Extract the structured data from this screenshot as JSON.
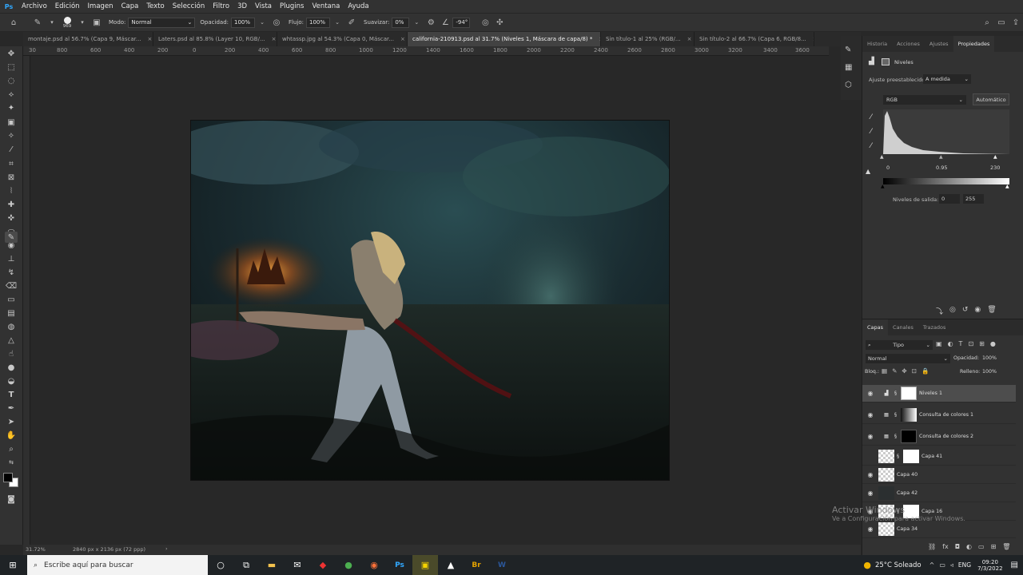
{
  "menu": {
    "logo": "Ps",
    "items": [
      "Archivo",
      "Edición",
      "Imagen",
      "Capa",
      "Texto",
      "Selección",
      "Filtro",
      "3D",
      "Vista",
      "Plugins",
      "Ventana",
      "Ayuda"
    ]
  },
  "options": {
    "brush_size": "969",
    "mode_label": "Modo:",
    "mode_value": "Normal",
    "opacity_label": "Opacidad:",
    "opacity_value": "100%",
    "flow_label": "Flujo:",
    "flow_value": "100%",
    "smooth_label": "Suavizar:",
    "smooth_value": "0%",
    "angle_value": "-94°"
  },
  "doc_tabs": [
    {
      "label": "montaje.psd al 56.7% (Capa 9, Máscar...",
      "active": false
    },
    {
      "label": "Laters.psd al 85.8% (Layer 10, RGB/...",
      "active": false
    },
    {
      "label": "whtassp.jpg al 54.3% (Capa 0, Máscar...",
      "active": false
    },
    {
      "label": "california-210913.psd al 31.7% (Niveles 1, Máscara de capa/8) *",
      "active": true
    },
    {
      "label": "Sin título-1 al 25% (RGB/...",
      "active": false
    },
    {
      "label": "Sin título-2 al 66.7% (Capa 6, RGB/8...",
      "active": false
    }
  ],
  "ruler_labels": [
    "30",
    "800",
    "600",
    "400",
    "200",
    "0",
    "200",
    "400",
    "600",
    "800",
    "1000",
    "1200",
    "1400",
    "1600",
    "1800",
    "2000",
    "2200",
    "2400",
    "2600",
    "2800",
    "3000",
    "3200",
    "3400",
    "3600"
  ],
  "status": {
    "zoom": "31.72%",
    "doc_info": "2840 px x 2136 px (72 ppp)"
  },
  "panel_tabs": [
    "Historia",
    "Acciones",
    "Ajustes",
    "Propiedades"
  ],
  "properties": {
    "title": "Niveles",
    "preset_label": "Ajuste preestablecido:",
    "preset_value": "A medida",
    "channel": "RGB",
    "auto_button": "Automático",
    "input_black": "0",
    "input_gamma": "0.95",
    "input_white": "230",
    "output_label": "Niveles de salida:",
    "output_black": "0",
    "output_white": "255"
  },
  "layers_tabs": [
    "Capas",
    "Canales",
    "Trazados"
  ],
  "layers_controls": {
    "filter_kind": "Tipo",
    "blend_mode": "Normal",
    "opacity_label": "Opacidad:",
    "opacity_value": "100%",
    "lock_label": "Bloq.:",
    "fill_label": "Relleno:",
    "fill_value": "100%"
  },
  "layers": [
    {
      "name": "Niveles 1",
      "visible": true,
      "selected": true,
      "kind": "levels",
      "mask": "white"
    },
    {
      "name": "Consulta de colores 1",
      "visible": true,
      "selected": false,
      "kind": "lookup",
      "mask": "gradient"
    },
    {
      "name": "Consulta de colores 2",
      "visible": true,
      "selected": false,
      "kind": "lookup",
      "mask": "black"
    },
    {
      "name": "Capa 41",
      "visible": false,
      "selected": false,
      "kind": "pixel",
      "mask": "white"
    },
    {
      "name": "Capa 40",
      "visible": true,
      "selected": false,
      "kind": "pixel",
      "mask": ""
    },
    {
      "name": "Capa 42",
      "visible": true,
      "selected": false,
      "kind": "photo",
      "mask": ""
    },
    {
      "name": "Capa 16",
      "visible": true,
      "selected": false,
      "kind": "pixel",
      "mask": "white"
    },
    {
      "name": "Capa 34",
      "visible": true,
      "selected": false,
      "kind": "pixel",
      "mask": ""
    }
  ],
  "watermark": {
    "line1": "Activar Windows",
    "line2": "Ve a Configuración para activar Windows."
  },
  "taskbar": {
    "search_placeholder": "Escribe aquí para buscar",
    "weather": "25°C  Soleado",
    "lang": "ENG",
    "time": "09:20",
    "date": "7/3/2022"
  }
}
